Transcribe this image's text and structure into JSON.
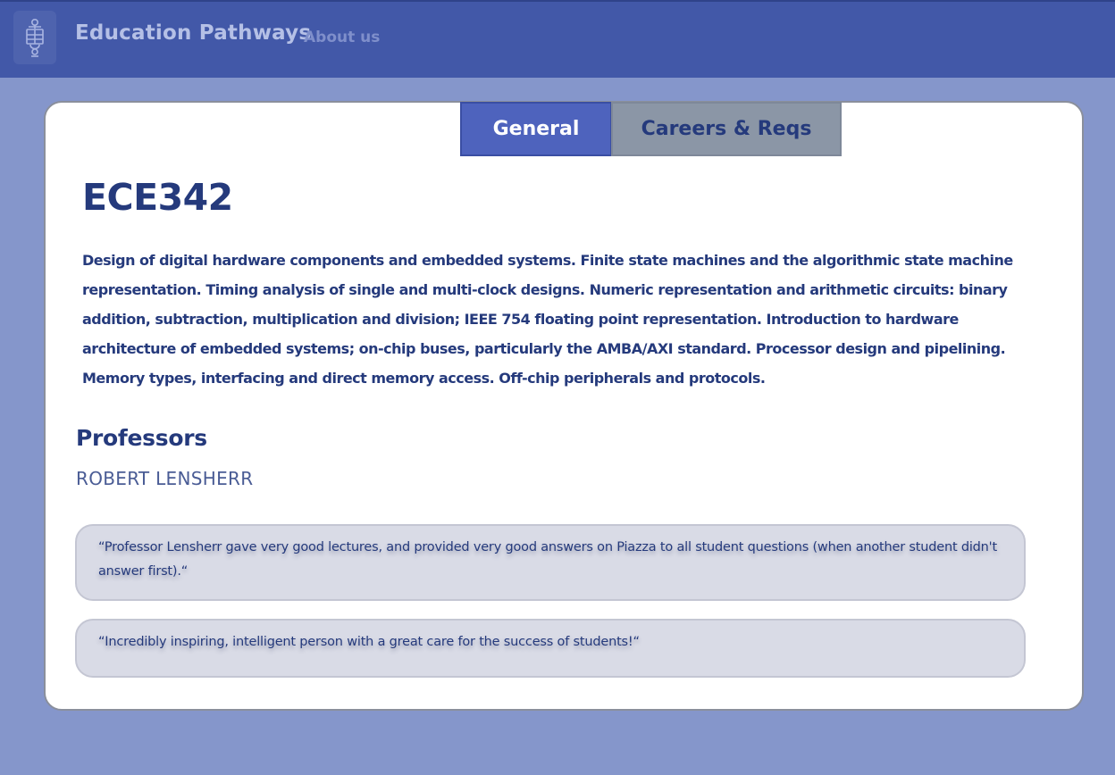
{
  "navbar": {
    "brand": "Education Pathways",
    "about_link": "About us",
    "logo_icon": "university-crest-icon"
  },
  "tabs": [
    {
      "label": "General",
      "active": true
    },
    {
      "label": "Careers & Reqs",
      "active": false
    }
  ],
  "course": {
    "code": "ECE342",
    "description": "Design of digital hardware components and embedded systems. Finite state machines and the algorithmic state machine representation. Timing analysis of single and multi-clock designs. Numeric representation and arithmetic circuits: binary addition, subtraction, multiplication and division; IEEE 754 floating point representation. Introduction to hardware architecture of embedded systems; on-chip buses, particularly the AMBA/AXI standard. Processor design and pipelining. Memory types, interfacing and direct memory access. Off-chip peripherals and protocols."
  },
  "professors": {
    "heading": "Professors",
    "name": "ROBERT LENSHERR"
  },
  "reviews": [
    "“Professor Lensherr gave very good lectures, and provided very good answers on Piazza to all student questions (when another student didn't answer first).“",
    "“Incredibly inspiring, intelligent person with a great care for the success of students!“"
  ],
  "colors": {
    "page_background": "#8596cb",
    "navbar": "#4258a8",
    "active_tab": "#4e63bd",
    "inactive_tab": "#8b96a6",
    "heading_text": "#253a7c",
    "review_bubble": "#d9dbe6"
  }
}
